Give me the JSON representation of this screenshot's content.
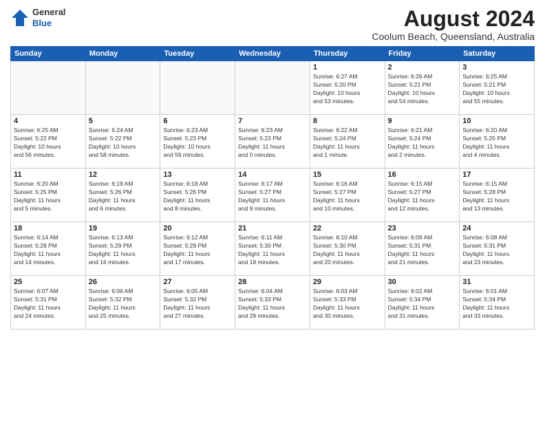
{
  "header": {
    "logo_general": "General",
    "logo_blue": "Blue",
    "month_year": "August 2024",
    "location": "Coolum Beach, Queensland, Australia"
  },
  "days_of_week": [
    "Sunday",
    "Monday",
    "Tuesday",
    "Wednesday",
    "Thursday",
    "Friday",
    "Saturday"
  ],
  "weeks": [
    [
      {
        "day": "",
        "info": ""
      },
      {
        "day": "",
        "info": ""
      },
      {
        "day": "",
        "info": ""
      },
      {
        "day": "",
        "info": ""
      },
      {
        "day": "1",
        "info": "Sunrise: 6:27 AM\nSunset: 5:20 PM\nDaylight: 10 hours\nand 53 minutes."
      },
      {
        "day": "2",
        "info": "Sunrise: 6:26 AM\nSunset: 5:21 PM\nDaylight: 10 hours\nand 54 minutes."
      },
      {
        "day": "3",
        "info": "Sunrise: 6:25 AM\nSunset: 5:21 PM\nDaylight: 10 hours\nand 55 minutes."
      }
    ],
    [
      {
        "day": "4",
        "info": "Sunrise: 6:25 AM\nSunset: 5:22 PM\nDaylight: 10 hours\nand 56 minutes."
      },
      {
        "day": "5",
        "info": "Sunrise: 6:24 AM\nSunset: 5:22 PM\nDaylight: 10 hours\nand 58 minutes."
      },
      {
        "day": "6",
        "info": "Sunrise: 6:23 AM\nSunset: 5:23 PM\nDaylight: 10 hours\nand 59 minutes."
      },
      {
        "day": "7",
        "info": "Sunrise: 6:23 AM\nSunset: 5:23 PM\nDaylight: 11 hours\nand 0 minutes."
      },
      {
        "day": "8",
        "info": "Sunrise: 6:22 AM\nSunset: 5:24 PM\nDaylight: 11 hours\nand 1 minute."
      },
      {
        "day": "9",
        "info": "Sunrise: 6:21 AM\nSunset: 5:24 PM\nDaylight: 11 hours\nand 2 minutes."
      },
      {
        "day": "10",
        "info": "Sunrise: 6:20 AM\nSunset: 5:25 PM\nDaylight: 11 hours\nand 4 minutes."
      }
    ],
    [
      {
        "day": "11",
        "info": "Sunrise: 6:20 AM\nSunset: 5:25 PM\nDaylight: 11 hours\nand 5 minutes."
      },
      {
        "day": "12",
        "info": "Sunrise: 6:19 AM\nSunset: 5:26 PM\nDaylight: 11 hours\nand 6 minutes."
      },
      {
        "day": "13",
        "info": "Sunrise: 6:18 AM\nSunset: 5:26 PM\nDaylight: 11 hours\nand 8 minutes."
      },
      {
        "day": "14",
        "info": "Sunrise: 6:17 AM\nSunset: 5:27 PM\nDaylight: 11 hours\nand 9 minutes."
      },
      {
        "day": "15",
        "info": "Sunrise: 6:16 AM\nSunset: 5:27 PM\nDaylight: 11 hours\nand 10 minutes."
      },
      {
        "day": "16",
        "info": "Sunrise: 6:15 AM\nSunset: 5:27 PM\nDaylight: 11 hours\nand 12 minutes."
      },
      {
        "day": "17",
        "info": "Sunrise: 6:15 AM\nSunset: 5:28 PM\nDaylight: 11 hours\nand 13 minutes."
      }
    ],
    [
      {
        "day": "18",
        "info": "Sunrise: 6:14 AM\nSunset: 5:28 PM\nDaylight: 11 hours\nand 14 minutes."
      },
      {
        "day": "19",
        "info": "Sunrise: 6:13 AM\nSunset: 5:29 PM\nDaylight: 11 hours\nand 16 minutes."
      },
      {
        "day": "20",
        "info": "Sunrise: 6:12 AM\nSunset: 5:29 PM\nDaylight: 11 hours\nand 17 minutes."
      },
      {
        "day": "21",
        "info": "Sunrise: 6:11 AM\nSunset: 5:30 PM\nDaylight: 11 hours\nand 18 minutes."
      },
      {
        "day": "22",
        "info": "Sunrise: 6:10 AM\nSunset: 5:30 PM\nDaylight: 11 hours\nand 20 minutes."
      },
      {
        "day": "23",
        "info": "Sunrise: 6:09 AM\nSunset: 5:31 PM\nDaylight: 11 hours\nand 21 minutes."
      },
      {
        "day": "24",
        "info": "Sunrise: 6:08 AM\nSunset: 5:31 PM\nDaylight: 11 hours\nand 23 minutes."
      }
    ],
    [
      {
        "day": "25",
        "info": "Sunrise: 6:07 AM\nSunset: 5:31 PM\nDaylight: 11 hours\nand 24 minutes."
      },
      {
        "day": "26",
        "info": "Sunrise: 6:06 AM\nSunset: 5:32 PM\nDaylight: 11 hours\nand 25 minutes."
      },
      {
        "day": "27",
        "info": "Sunrise: 6:05 AM\nSunset: 5:32 PM\nDaylight: 11 hours\nand 27 minutes."
      },
      {
        "day": "28",
        "info": "Sunrise: 6:04 AM\nSunset: 5:33 PM\nDaylight: 11 hours\nand 28 minutes."
      },
      {
        "day": "29",
        "info": "Sunrise: 6:03 AM\nSunset: 5:33 PM\nDaylight: 11 hours\nand 30 minutes."
      },
      {
        "day": "30",
        "info": "Sunrise: 6:02 AM\nSunset: 5:34 PM\nDaylight: 11 hours\nand 31 minutes."
      },
      {
        "day": "31",
        "info": "Sunrise: 6:01 AM\nSunset: 5:34 PM\nDaylight: 11 hours\nand 33 minutes."
      }
    ]
  ]
}
